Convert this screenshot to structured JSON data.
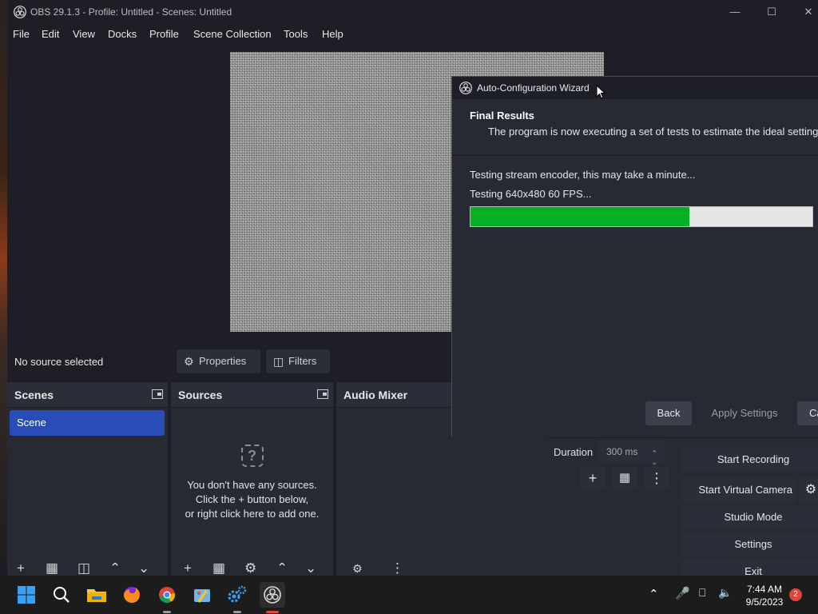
{
  "window": {
    "title": "OBS 29.1.3 - Profile: Untitled - Scenes: Untitled",
    "min_icon": "minimize-icon",
    "max_icon": "maximize-icon",
    "close_icon": "close-icon"
  },
  "menu": [
    "File",
    "Edit",
    "View",
    "Docks",
    "Profile",
    "Scene Collection",
    "Tools",
    "Help"
  ],
  "source_toolbar": {
    "no_source": "No source selected",
    "properties": "Properties",
    "filters": "Filters"
  },
  "docks": {
    "scenes": {
      "title": "Scenes",
      "items": [
        "Scene"
      ]
    },
    "sources": {
      "title": "Sources",
      "empty_lines": [
        "You don't have any sources.",
        "Click the + button below,",
        "or right click here to add one."
      ]
    },
    "audio_mixer": {
      "title": "Audio Mixer"
    }
  },
  "transitions": {
    "duration_label": "Duration",
    "duration_value": "300 ms"
  },
  "controls": {
    "start_recording": "Start Recording",
    "start_virtual_camera": "Start Virtual Camera",
    "studio_mode": "Studio Mode",
    "settings": "Settings",
    "exit": "Exit"
  },
  "wizard": {
    "title": "Auto-Configuration Wizard",
    "heading": "Final Results",
    "subheading": "The program is now executing a set of tests to estimate the ideal settings.",
    "status_line": "Testing stream encoder, this may take a minute...",
    "test_line": "Testing 640x480 60 FPS...",
    "progress_percent": 64,
    "progress_color": "#06b025",
    "buttons": {
      "back": "Back",
      "apply": "Apply Settings",
      "cancel": "Cancel"
    }
  },
  "taskbar": {
    "icons": [
      "windows-start-icon",
      "search-icon",
      "file-explorer-icon",
      "firefox-icon",
      "chrome-icon",
      "paint-icon",
      "settings-gears-icon",
      "obs-icon"
    ],
    "time": "7:44 AM",
    "date": "9/5/2023",
    "notification_count": "2"
  },
  "colors": {
    "accent": "#284cb8",
    "panel": "#272a33",
    "background": "#1e1f26"
  }
}
